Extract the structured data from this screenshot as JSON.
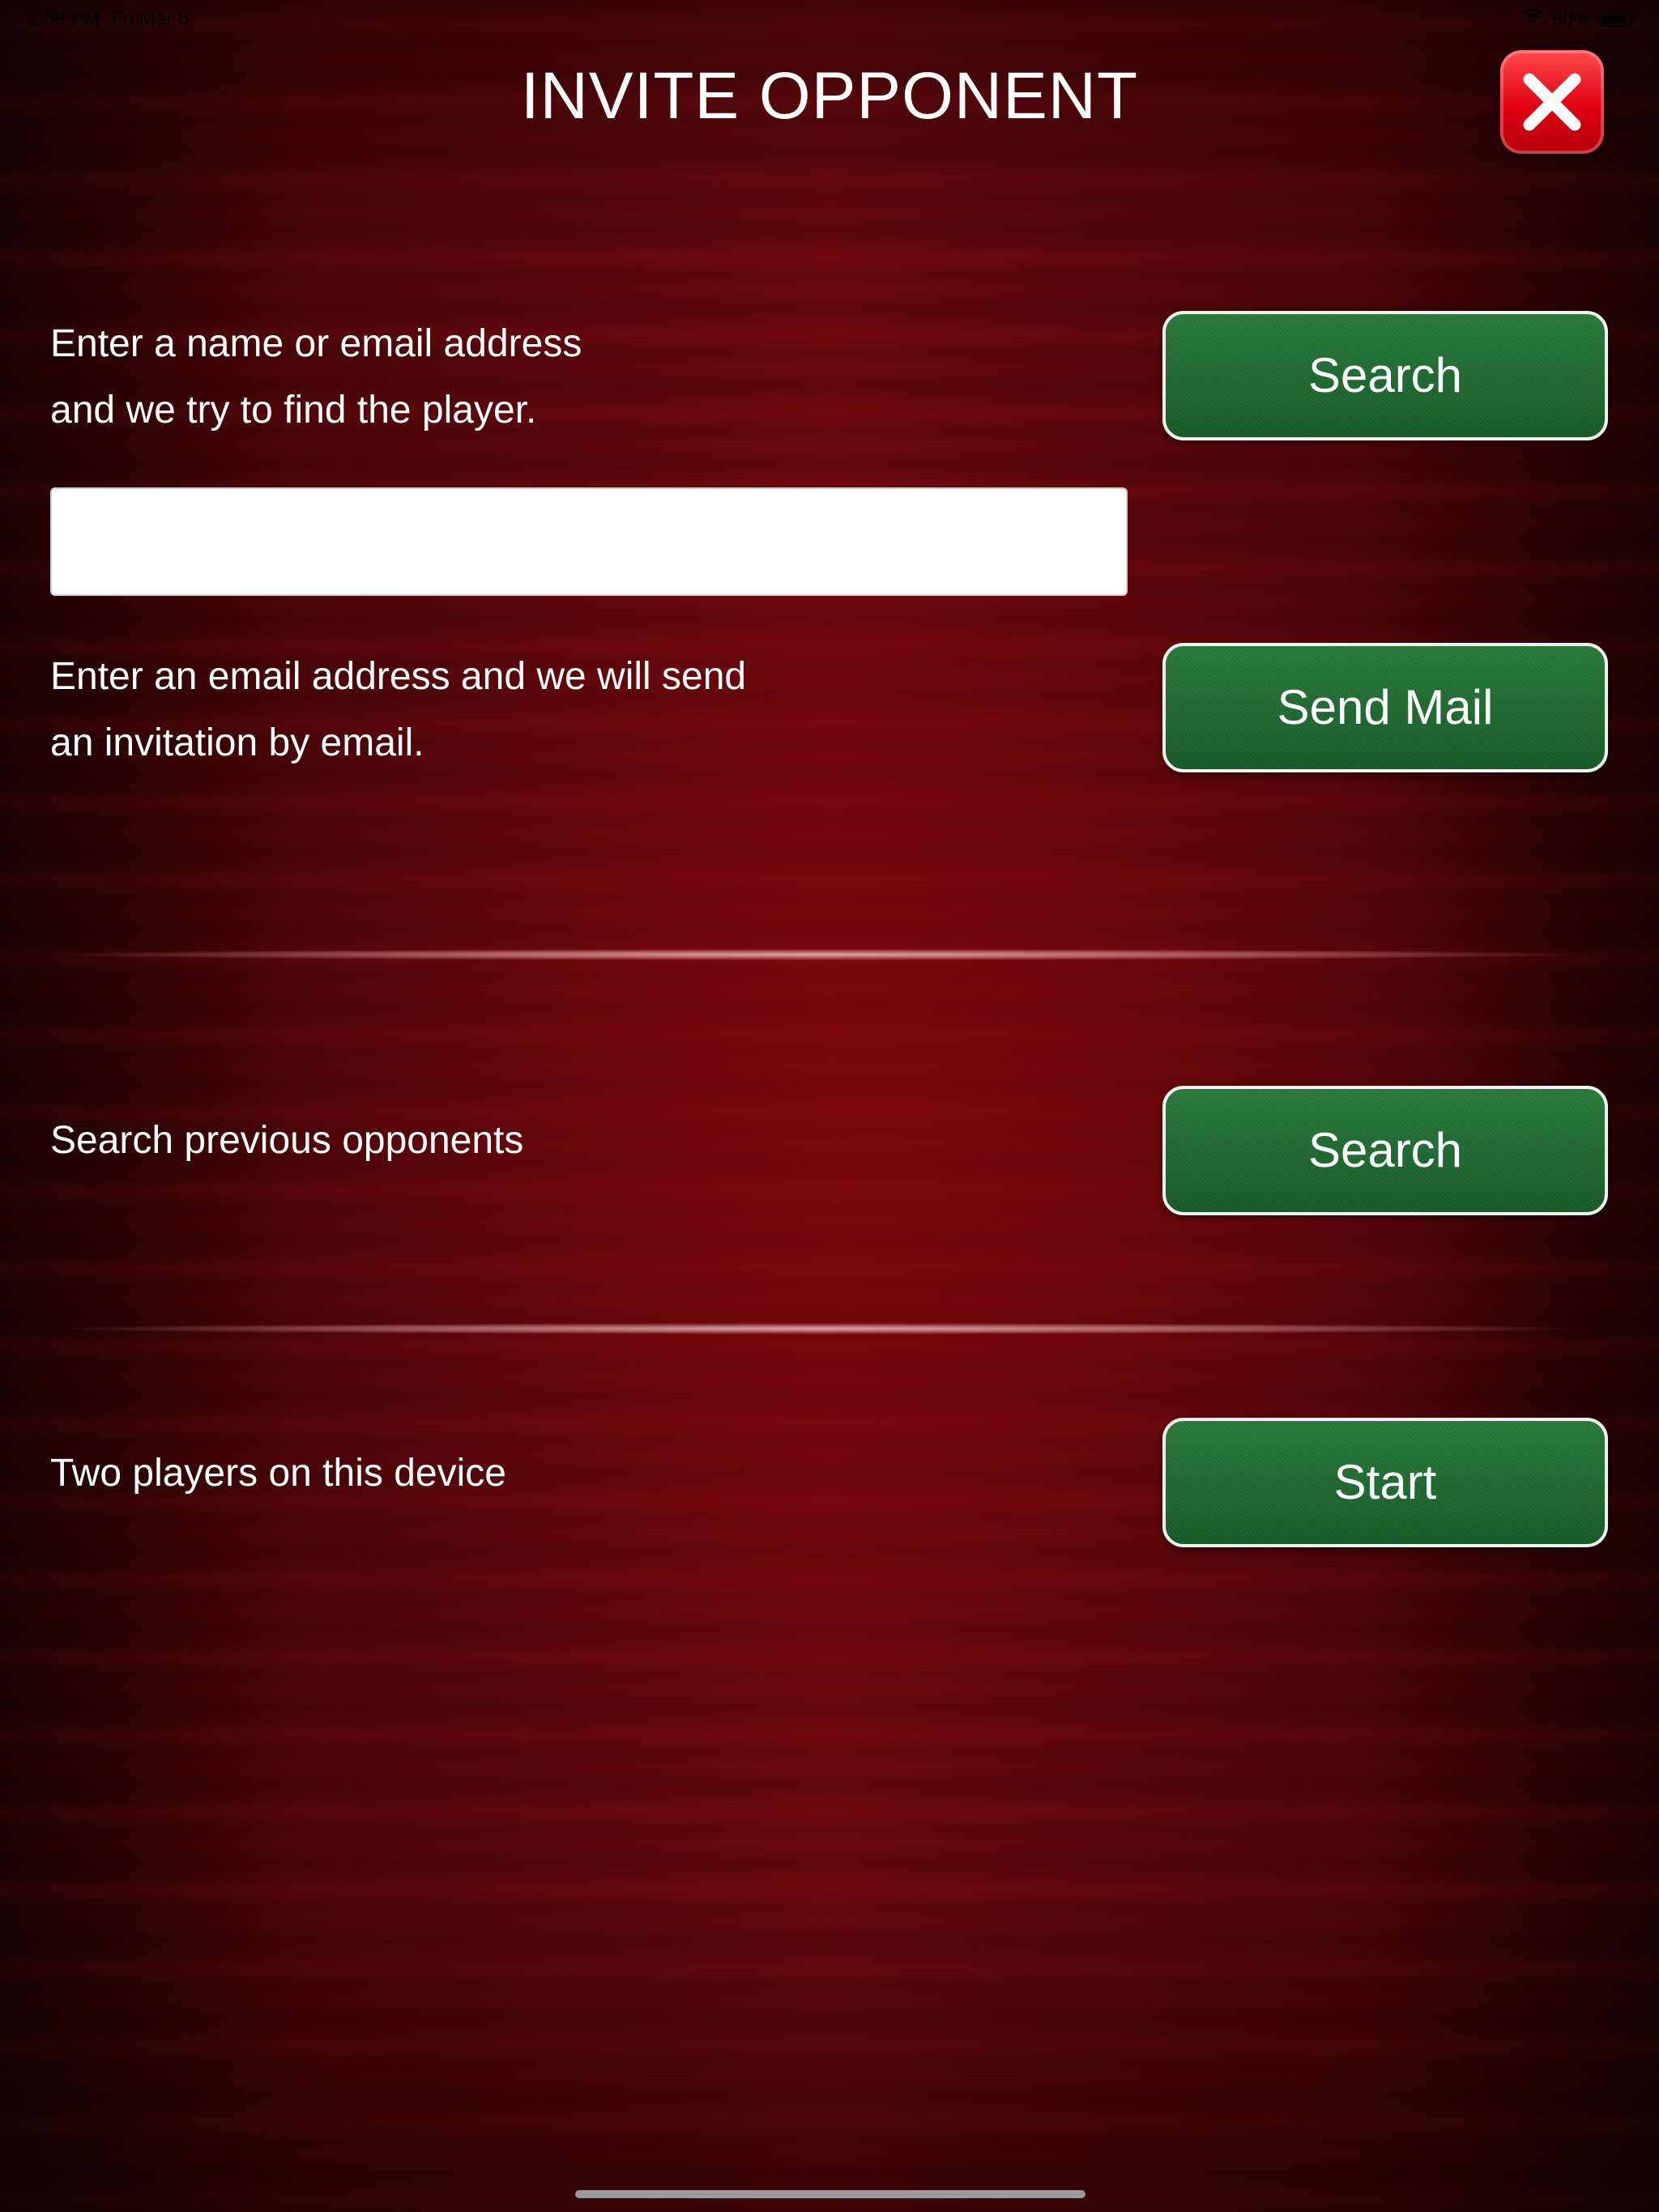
{
  "status_bar": {
    "time": "2:09 PM",
    "date": "Fri Mar 6",
    "battery": "90%",
    "battery_level": 0.9
  },
  "header": {
    "title": "INVITE OPPONENT",
    "close_icon": "close-x-icon"
  },
  "find_player": {
    "description_line1": "Enter a name or email address",
    "description_line2": "and we try to find the player.",
    "input_value": "",
    "input_placeholder": "",
    "button_label": "Search"
  },
  "email_invite": {
    "description_line1": "Enter an email address and we will send",
    "description_line2": "an invitation by email.",
    "button_label": "Send Mail"
  },
  "previous_opponents": {
    "description": "Search previous opponents",
    "button_label": "Search"
  },
  "local_game": {
    "description": "Two players on this device",
    "button_label": "Start"
  },
  "colors": {
    "background": "#6a080c",
    "button_green": "#1f6a30",
    "close_red": "#e00012"
  }
}
